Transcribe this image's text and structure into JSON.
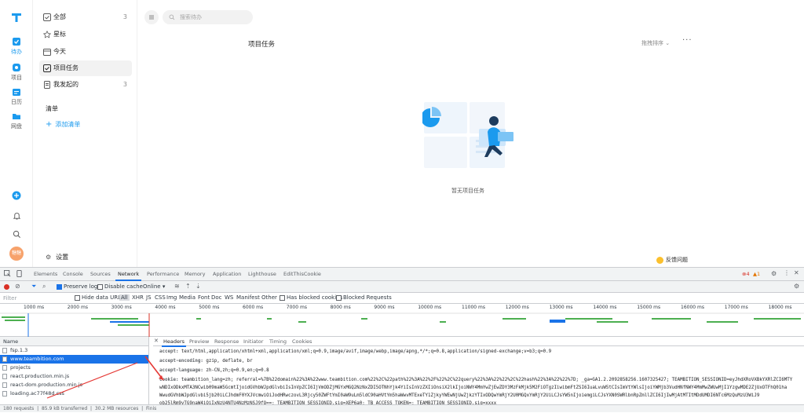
{
  "colors": {
    "accent": "#1b9aee",
    "danger": "#d93025",
    "devtools_blue": "#1a73e8"
  },
  "rail": {
    "items": [
      {
        "label": "待办",
        "icon": "check-square-icon",
        "active": true
      },
      {
        "label": "项目",
        "icon": "project-icon"
      },
      {
        "label": "日历",
        "icon": "calendar-icon"
      },
      {
        "label": "网盘",
        "icon": "folder-icon"
      }
    ],
    "avatar_text": "糖糖"
  },
  "sidebar": {
    "items": [
      {
        "label": "全部",
        "count": "3",
        "icon": "checkbox-icon"
      },
      {
        "label": "星标",
        "count": "",
        "icon": "star-icon"
      },
      {
        "label": "今天",
        "count": "",
        "icon": "calendar-day-icon"
      },
      {
        "label": "项目任务",
        "count": "",
        "icon": "project-task-icon",
        "active": true
      },
      {
        "label": "我发起的",
        "count": "3",
        "icon": "doc-icon"
      }
    ],
    "section_title": "清单",
    "add_list": "添加清单",
    "settings": "设置"
  },
  "main": {
    "search_placeholder": "搜索待办",
    "title": "项目任务",
    "sort": "拖拽排序",
    "more": "···",
    "empty_text": "暂无项目任务",
    "feedback": "反馈问题"
  },
  "devtools": {
    "tabs": [
      "Elements",
      "Console",
      "Sources",
      "Network",
      "Performance",
      "Memory",
      "Application",
      "Lighthouse",
      "EditThisCookie"
    ],
    "active_tab": "Network",
    "errors": "4",
    "warnings": "1",
    "toolbar": {
      "preserve_log": "Preserve log",
      "disable_cache": "Disable cache",
      "throttle": "Online"
    },
    "filter": {
      "placeholder": "Filter",
      "hide_data_urls": "Hide data URLs",
      "types": [
        "All",
        "XHR",
        "JS",
        "CSS",
        "Img",
        "Media",
        "Font",
        "Doc",
        "WS",
        "Manifest",
        "Other"
      ],
      "has_blocked_cookies": "Has blocked cookies",
      "blocked_requests": "Blocked Requests"
    },
    "ruler": [
      "1000 ms",
      "2000 ms",
      "3000 ms",
      "4000 ms",
      "5000 ms",
      "6000 ms",
      "7000 ms",
      "8000 ms",
      "9000 ms",
      "10000 ms",
      "11000 ms",
      "12000 ms",
      "13000 ms",
      "14000 ms",
      "15000 ms",
      "16000 ms",
      "17000 ms",
      "18000 ms"
    ],
    "names_header": "Name",
    "requests": [
      "fsp.1.3",
      "www.teambition.com",
      "projects",
      "react.production.min.js",
      "react-dom.production.min.js",
      "loading.ac77f48d.css"
    ],
    "selected_request": "www.teambition.com",
    "detail_tabs": [
      "Headers",
      "Preview",
      "Response",
      "Initiator",
      "Timing",
      "Cookies"
    ],
    "headers": [
      {
        "key": "accept:",
        "value": " text/html,application/xhtml+xml,application/xml;q=0.9,image/avif,image/webp,image/apng,*/*;q=0.8,application/signed-exchange;v=b3;q=0.9"
      },
      {
        "key": "accept-encoding:",
        "value": " gzip, deflate, br"
      },
      {
        "key": "accept-language:",
        "value": " zh-CN,zh;q=0.9,en;q=0.8"
      },
      {
        "key": "cookie:",
        "value": " teambition_lang=zh; referral=%7B%22domain%22%3A%22www.teambition.com%22%2C%22path%22%3A%22%2F%22%2C%22query%22%3A%22%22%2C%22hash%22%3A%22%22%7D; _ga=GA1.2.2092858256.1607325427; TEAMBITION_SESSIONID=eyJhdXRoVXBkYXRlZCI6MTY"
      },
      {
        "key": "",
        "value": "wNDIxODkxMTA3NCwib09maW5GcmtIjoidGVhbWJpdGlvbiIsInVpZCI6IjVmODZjMGYxMGQ2NzNxZDI5OTNhYjk4YiIsInVzZXIiOnsiX2lkIjoiNWY4MmYwZjEwZDY3MzFkMjk5M2FiOTgzIiwibmFtZSI6IuaLvuW5tCIsImVtYWlsIjoiYWMjb3VudHNfNWY4MmMwZWUwMjI1YzgwMDE2ZjUxOTFhQ01ha"
      },
      {
        "key": "",
        "value": "WwudGVhbWJpdGlvbi5jb20iLCJhdmF0YXJVcmwiOiJodHRwczovL3Rjcy50ZWFtYmI0aW9uLm5ldC90aHVtYm5haWwvMTExeTY1ZjkyYWEwNjUwZjkzYTIxODQwYmRjY2U0MGQxYmRjY2UiLCJsYW5nIjoiemgiLCJsYXN0SWRlbnRpZmllZCI6IjIwMjAtMTItMDdUMDI6NTc6MzQuMzU3WiJ9"
      },
      {
        "key": "",
        "value": "ob25lRm9yTG9naW4iOiIxNzU4NTU4NzMzNSJ9fQ==; TEAMBITION_SESSIONID.sig=XEP6a0; TB_ACCESS_TOKEN=; TEAMBITION_SESSIONID.sig=xxxx"
      }
    ],
    "status": {
      "requests": "180 requests",
      "transferred": "85.9 kB transferred",
      "resources": "30.2 MB resources",
      "finish": "Finis"
    }
  }
}
